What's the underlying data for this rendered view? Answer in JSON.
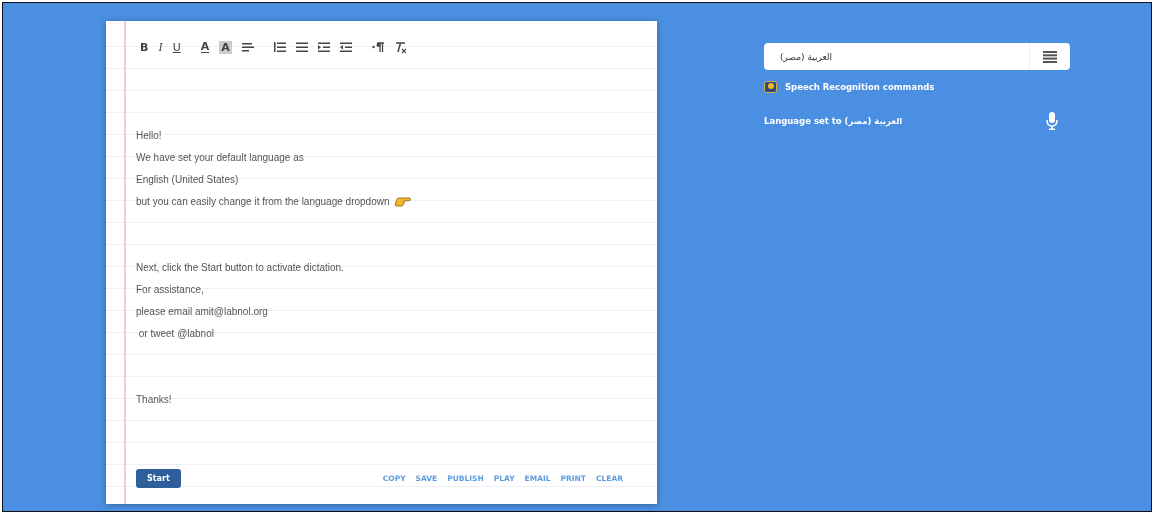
{
  "editor": {
    "toolbar": {
      "bold": "B",
      "italic": "I",
      "underline": "U",
      "text_color": "A",
      "highlight": "A"
    },
    "paragraphs": [
      [
        "Hello!",
        "We have set your default language as",
        "English (United States)",
        "but you can easily change it from the language dropdown"
      ],
      [
        "Next, click the Start button to activate dictation.",
        "For assistance,",
        "please email amit@labnol.org",
        " or tweet @labnol"
      ],
      [
        "Thanks!"
      ]
    ],
    "start_button": "Start",
    "actions": [
      "COPY",
      "SAVE",
      "PUBLISH",
      "PLAY",
      "EMAIL",
      "PRINT",
      "CLEAR"
    ]
  },
  "panel": {
    "language_select": {
      "value": "العربية (مصر)"
    },
    "commands_link": "Speech Recognition commands",
    "status": "Language set to العربية (مصر)"
  }
}
